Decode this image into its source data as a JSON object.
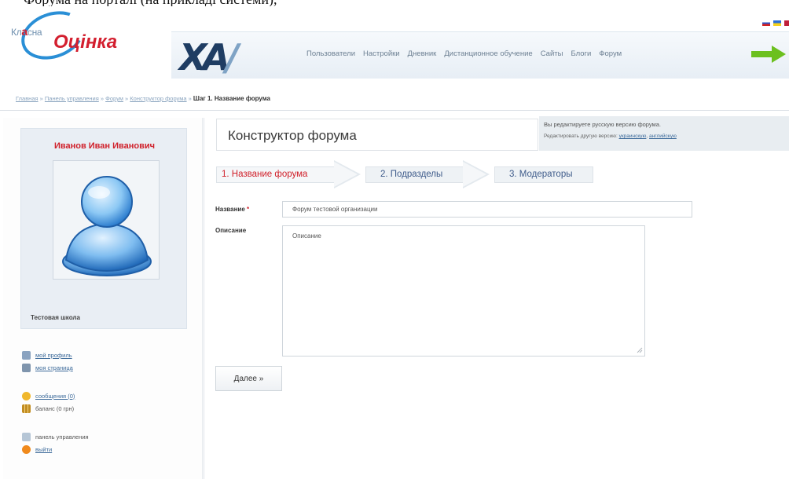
{
  "doc_strip_text": "Форума на порталі (на прикладі системи),",
  "logo": {
    "line1_pre": "Кл",
    "line1_mid": "а",
    "line1_post": "сна",
    "line2": "Оцінка"
  },
  "brand": "XA",
  "nav": {
    "items": [
      "Пользователи",
      "Настройки",
      "Дневник",
      "Дистанционное обучение",
      "Сайты",
      "Блоги",
      "Форум"
    ]
  },
  "breadcrumb": {
    "links": [
      "Главная",
      "Панель управления",
      "Форум",
      "Конструктор форума"
    ],
    "separator": " » ",
    "current": "Шаг 1. Название форума"
  },
  "profile": {
    "name": "Иванов Иван Иванович",
    "school": "Тестовая школа"
  },
  "side_links": {
    "my_profile": "мой профиль",
    "my_page": "моя страница",
    "messages": "сообщения (0)",
    "balance": "баланс (0 грн)",
    "control_panel": "панель управления",
    "logout": "выйти"
  },
  "page_title": "Конструктор форума",
  "version": {
    "line1": "Вы редактируете русскую версию форума.",
    "line2_prefix": "Редактировать другую версию:",
    "link_ua": "украинскую",
    "link_en": "английскую"
  },
  "steps": [
    "1. Название форума",
    "2. Подразделы",
    "3. Модераторы"
  ],
  "form": {
    "name_label": "Название",
    "required_mark": "*",
    "name_value": "Форум тестовой организации",
    "description_label": "Описание",
    "description_value": "Описание",
    "next_button": "Далее »"
  },
  "colors": {
    "accent_red": "#d0202a",
    "link_blue": "#3c6a9a",
    "logo_blue": "#2a8fd6",
    "arrow_green": "#6cc01f"
  }
}
